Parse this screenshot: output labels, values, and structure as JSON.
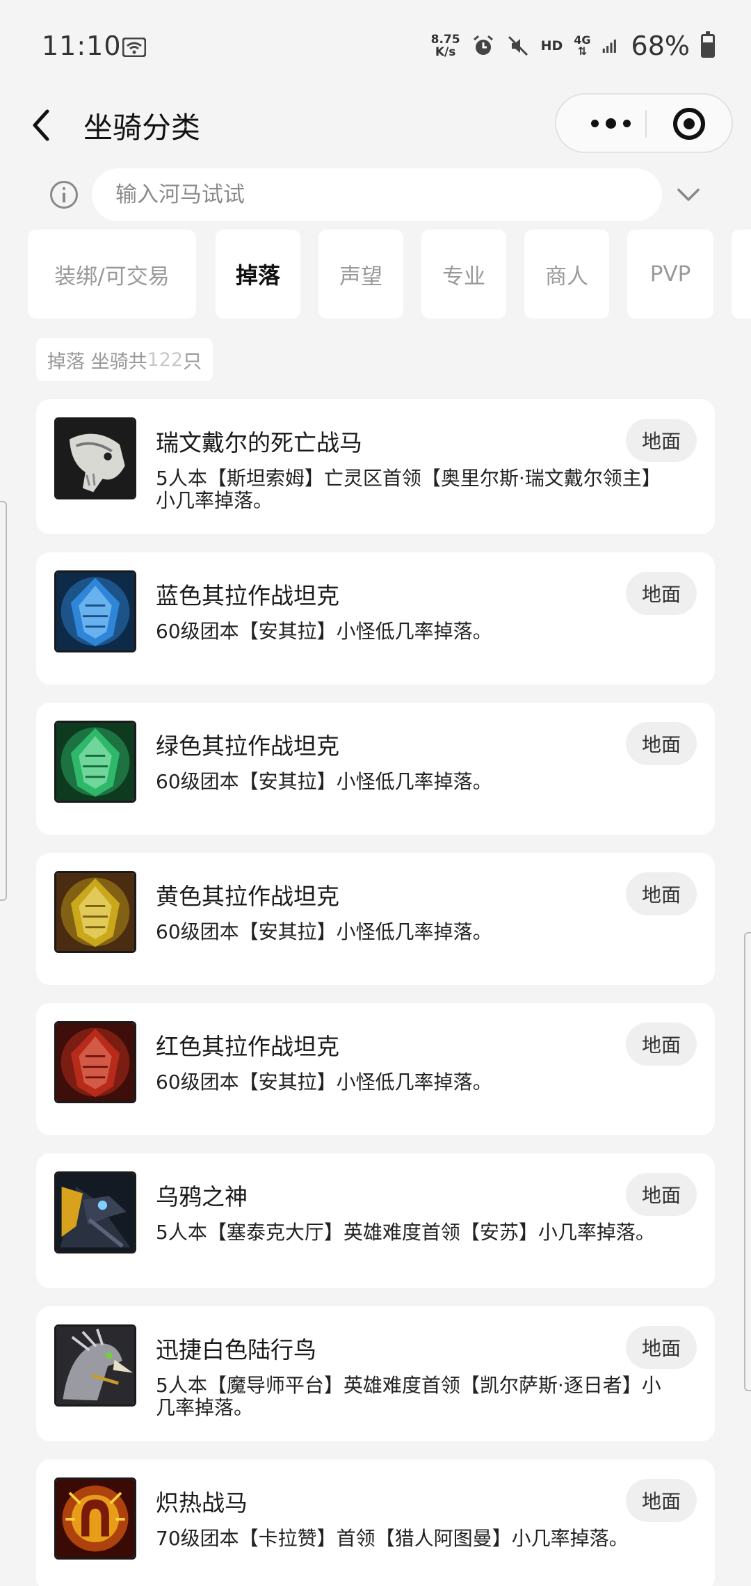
{
  "status_bar": {
    "time": "11:10",
    "net_speed_value": "8.75",
    "net_speed_unit": "K/s",
    "hd": "HD",
    "network_type": "4G",
    "battery_percent_text": "68%",
    "battery_level": 0.68
  },
  "nav": {
    "title": "坐骑分类"
  },
  "search": {
    "placeholder": "输入河马试试",
    "value": ""
  },
  "tabs": [
    {
      "label": "装绑/可交易",
      "active": false
    },
    {
      "label": "掉落",
      "active": true
    },
    {
      "label": "声望",
      "active": false
    },
    {
      "label": "专业",
      "active": false
    },
    {
      "label": "商人",
      "active": false
    },
    {
      "label": "PVP",
      "active": false
    }
  ],
  "count": {
    "prefix": "掉落 坐骑共",
    "number": "122",
    "suffix": "只"
  },
  "mounts": [
    {
      "name": "瑞文戴尔的死亡战马",
      "desc": "5人本【斯坦索姆】亡灵区首领【奥里尔斯·瑞文戴尔领主】小几率掉落。",
      "tag": "地面",
      "icon": "bone-horse-icon"
    },
    {
      "name": "蓝色其拉作战坦克",
      "desc": "60级团本【安其拉】小怪低几率掉落。",
      "tag": "地面",
      "icon": "blue-crystal-icon"
    },
    {
      "name": "绿色其拉作战坦克",
      "desc": "60级团本【安其拉】小怪低几率掉落。",
      "tag": "地面",
      "icon": "green-crystal-icon"
    },
    {
      "name": "黄色其拉作战坦克",
      "desc": "60级团本【安其拉】小怪低几率掉落。",
      "tag": "地面",
      "icon": "yellow-crystal-icon"
    },
    {
      "name": "红色其拉作战坦克",
      "desc": "60级团本【安其拉】小怪低几率掉落。",
      "tag": "地面",
      "icon": "red-crystal-icon"
    },
    {
      "name": "乌鸦之神",
      "desc": "5人本【塞泰克大厅】英雄难度首领【安苏】小几率掉落。",
      "tag": "地面",
      "icon": "raven-lord-icon"
    },
    {
      "name": "迅捷白色陆行鸟",
      "desc": "5人本【魔导师平台】英雄难度首领【凯尔萨斯·逐日者】小几率掉落。",
      "tag": "地面",
      "icon": "hawkstrider-icon"
    },
    {
      "name": "炽热战马",
      "desc": "70级团本【卡拉赞】首领【猎人阿图曼】小几率掉落。",
      "tag": "地面",
      "icon": "fiery-horseshoe-icon"
    }
  ],
  "colors": {
    "background": "#f4f4f4",
    "card": "#ffffff",
    "tag_bg": "#efefef",
    "muted_text": "#999999",
    "crystal_blue": "#2f86d8",
    "crystal_green": "#2fb86a",
    "crystal_yellow": "#d6b21c",
    "crystal_red": "#c8301e"
  }
}
